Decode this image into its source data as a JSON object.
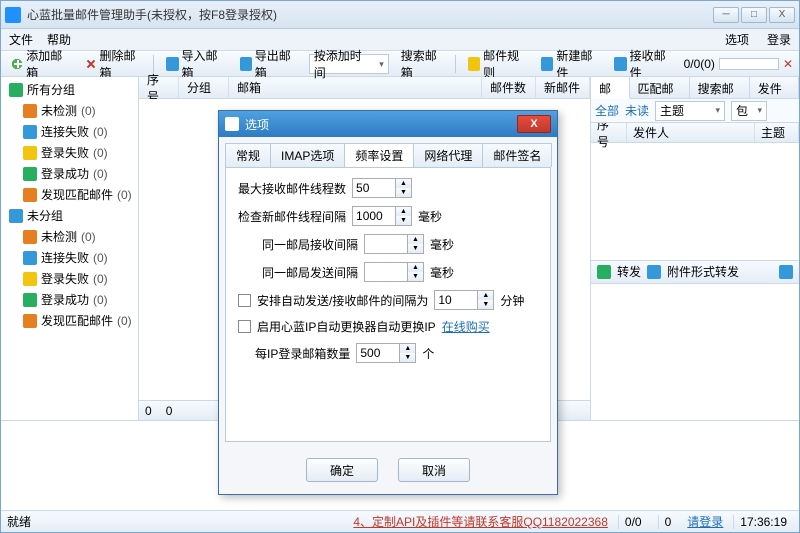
{
  "title": "心蓝批量邮件管理助手(未授权，按F8登录授权)",
  "menu": {
    "file": "文件",
    "help": "帮助",
    "options": "选项",
    "login": "登录"
  },
  "toolbar": {
    "add_mailbox": "添加邮箱",
    "del_mailbox": "删除邮箱",
    "import_mailbox": "导入邮箱",
    "export_mailbox": "导出邮箱",
    "sort": "按添加时间",
    "search_mailbox": "搜索邮箱",
    "mail_rules": "邮件规则",
    "new_mail": "新建邮件",
    "receive": "接收邮件",
    "counts": "0/0(0)",
    "cancel_icon": "✕"
  },
  "sidebar": {
    "all_groups": "所有分组",
    "items1": [
      {
        "label": "未检测",
        "cnt": "(0)",
        "ic": "orange"
      },
      {
        "label": "连接失败",
        "cnt": "(0)",
        "ic": "blue"
      },
      {
        "label": "登录失败",
        "cnt": "(0)",
        "ic": "yellow"
      },
      {
        "label": "登录成功",
        "cnt": "(0)",
        "ic": "green"
      },
      {
        "label": "发现匹配邮件",
        "cnt": "(0)",
        "ic": "orange"
      }
    ],
    "ungrouped": "未分组",
    "items2": [
      {
        "label": "未检测",
        "cnt": "(0)",
        "ic": "orange"
      },
      {
        "label": "连接失败",
        "cnt": "(0)",
        "ic": "blue"
      },
      {
        "label": "登录失败",
        "cnt": "(0)",
        "ic": "yellow"
      },
      {
        "label": "登录成功",
        "cnt": "(0)",
        "ic": "green"
      },
      {
        "label": "发现匹配邮件",
        "cnt": "(0)",
        "ic": "orange"
      }
    ]
  },
  "list": {
    "cols": [
      "序号",
      "分组",
      "邮箱",
      "邮件数",
      "新邮件"
    ],
    "foot_zero": "0"
  },
  "right": {
    "tabs": [
      "邮件",
      "匹配邮件",
      "搜索邮件",
      "发件箱"
    ],
    "filters": {
      "all": "全部",
      "unread": "未读",
      "subject": "主题",
      "include": "包"
    },
    "cols": [
      "序号",
      "发件人",
      "主题"
    ]
  },
  "forward": {
    "label": "转发",
    "attach": "附件形式转发"
  },
  "status": {
    "ready": "就绪",
    "promo": "4、定制API及插件等请联系客服QQ1182022368",
    "nums": "0/0",
    "zero": "0",
    "login_link": "请登录",
    "time": "17:36:19"
  },
  "modal": {
    "title": "选项",
    "tabs": [
      "常规",
      "IMAP选项",
      "频率设置",
      "网络代理",
      "邮件签名"
    ],
    "active_tab": 2,
    "rows": {
      "max_threads": {
        "label": "最大接收邮件线程数",
        "val": "50"
      },
      "check_interval": {
        "label": "检查新邮件线程间隔",
        "val": "1000",
        "unit": "毫秒"
      },
      "same_recv": {
        "label": "同一邮局接收间隔",
        "val": "",
        "unit": "毫秒"
      },
      "same_send": {
        "label": "同一邮局发送间隔",
        "val": "",
        "unit": "毫秒"
      },
      "auto_arrange": {
        "label": "安排自动发送/接收邮件的间隔为",
        "val": "10",
        "unit": "分钟"
      },
      "auto_ip": {
        "label": "启用心蓝IP自动更换器自动更换IP",
        "link": "在线购买"
      },
      "login_per_ip": {
        "label": "每IP登录邮箱数量",
        "val": "500",
        "unit": "个"
      }
    },
    "ok": "确定",
    "cancel": "取消"
  }
}
